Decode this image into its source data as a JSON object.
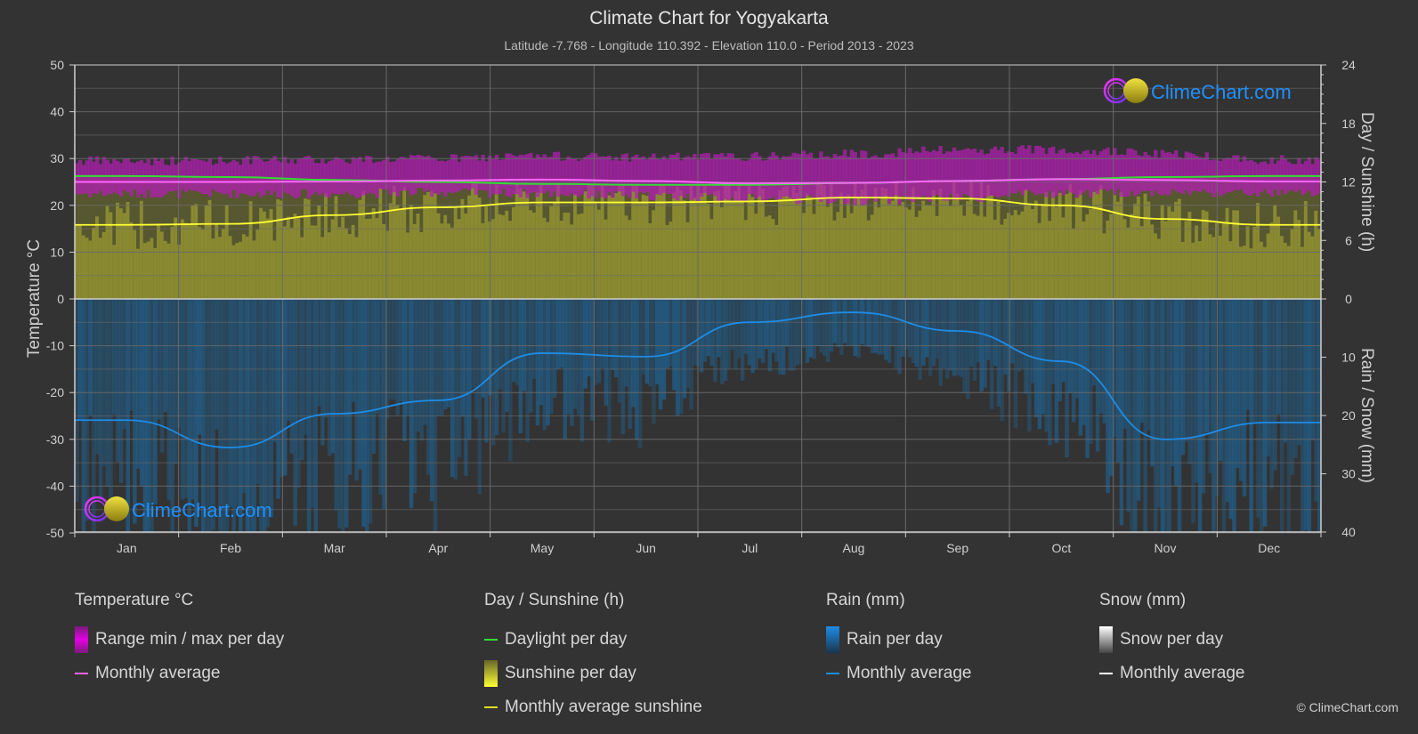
{
  "header": {
    "title": "Climate Chart for Yogyakarta",
    "subtitle": "Latitude -7.768 - Longitude 110.392 - Elevation 110.0 - Period 2013 - 2023"
  },
  "watermark": {
    "text": "ClimeChart.com"
  },
  "copyright": "© ClimeChart.com",
  "colors": {
    "background": "#333333",
    "temp_range": "#c81ec8",
    "temp_avg": "#ff66ff",
    "daylight": "#33dd33",
    "sunshine_fill": "#8c8c32",
    "sunshine_avg": "#ffff33",
    "rain_fill": "#1e6496",
    "rain_avg": "#1e8ce6",
    "watermark_text": "#1e90ff"
  },
  "legend": {
    "groups": [
      {
        "title": "Temperature °C",
        "items": [
          {
            "label": "Range min / max per day",
            "swatch": "box",
            "color": "#e600e6"
          },
          {
            "label": "Monthly average",
            "swatch": "line",
            "color": "#ff66ff"
          }
        ]
      },
      {
        "title": "Day / Sunshine (h)",
        "items": [
          {
            "label": "Daylight per day",
            "swatch": "line",
            "color": "#33dd33"
          },
          {
            "label": "Sunshine per day",
            "swatch": "box",
            "color": "#ffff33"
          },
          {
            "label": "Monthly average sunshine",
            "swatch": "line",
            "color": "#dddd22"
          }
        ]
      },
      {
        "title": "Rain (mm)",
        "items": [
          {
            "label": "Rain per day",
            "swatch": "box",
            "color": "#1e8ce6"
          },
          {
            "label": "Monthly average",
            "swatch": "line",
            "color": "#1e8ce6"
          }
        ]
      },
      {
        "title": "Snow (mm)",
        "items": [
          {
            "label": "Snow per day",
            "swatch": "box",
            "color": "#ffffff"
          },
          {
            "label": "Monthly average",
            "swatch": "line",
            "color": "#ffffff"
          }
        ]
      }
    ]
  },
  "chart_data": {
    "type": "line",
    "title": "Climate Chart for Yogyakarta",
    "categories": [
      "Jan",
      "Feb",
      "Mar",
      "Apr",
      "May",
      "Jun",
      "Jul",
      "Aug",
      "Sep",
      "Oct",
      "Nov",
      "Dec"
    ],
    "axes": {
      "left": {
        "label": "Temperature °C",
        "range": [
          -50,
          50
        ],
        "ticks": [
          50,
          40,
          30,
          20,
          10,
          0,
          -10,
          -20,
          -30,
          -40,
          -50
        ]
      },
      "right_top": {
        "label": "Day / Sunshine (h)",
        "range": [
          0,
          24
        ],
        "ticks": [
          24,
          18,
          12,
          6,
          0
        ]
      },
      "right_bottom": {
        "label": "Rain / Snow (mm)",
        "range": [
          0,
          40
        ],
        "ticks": [
          0,
          10,
          20,
          30,
          40
        ]
      }
    },
    "grid": true,
    "series": [
      {
        "name": "Temperature monthly average (°C)",
        "axis": "left",
        "values": [
          25.0,
          25.0,
          25.1,
          25.3,
          25.5,
          25.2,
          24.7,
          24.8,
          25.2,
          25.6,
          25.4,
          25.1
        ]
      },
      {
        "name": "Temperature daily max (°C, approx)",
        "axis": "left",
        "values": [
          29.5,
          29.6,
          29.8,
          30.0,
          30.5,
          30.3,
          30.4,
          31.0,
          31.8,
          32.0,
          31.0,
          29.8
        ]
      },
      {
        "name": "Temperature daily min (°C, approx)",
        "axis": "left",
        "values": [
          22.5,
          22.5,
          22.5,
          22.8,
          22.5,
          22.0,
          21.5,
          21.0,
          21.5,
          22.5,
          22.8,
          22.6
        ]
      },
      {
        "name": "Daylight per day (h)",
        "axis": "right_top",
        "values": [
          12.6,
          12.5,
          12.2,
          12.0,
          11.8,
          11.7,
          11.7,
          11.9,
          12.1,
          12.3,
          12.5,
          12.6
        ]
      },
      {
        "name": "Monthly average sunshine (h)",
        "axis": "right_top",
        "values": [
          7.6,
          7.7,
          8.6,
          9.4,
          9.9,
          9.9,
          10.0,
          10.4,
          10.3,
          9.6,
          8.2,
          7.6
        ]
      },
      {
        "name": "Rain monthly average (mm)",
        "axis": "right_bottom",
        "values": [
          20.8,
          25.5,
          19.7,
          17.4,
          9.3,
          9.9,
          4.0,
          2.3,
          5.5,
          10.7,
          24.1,
          21.2
        ]
      },
      {
        "name": "Snow monthly average (mm)",
        "axis": "right_bottom",
        "values": [
          0,
          0,
          0,
          0,
          0,
          0,
          0,
          0,
          0,
          0,
          0,
          0
        ]
      }
    ],
    "legend_position": "bottom"
  }
}
